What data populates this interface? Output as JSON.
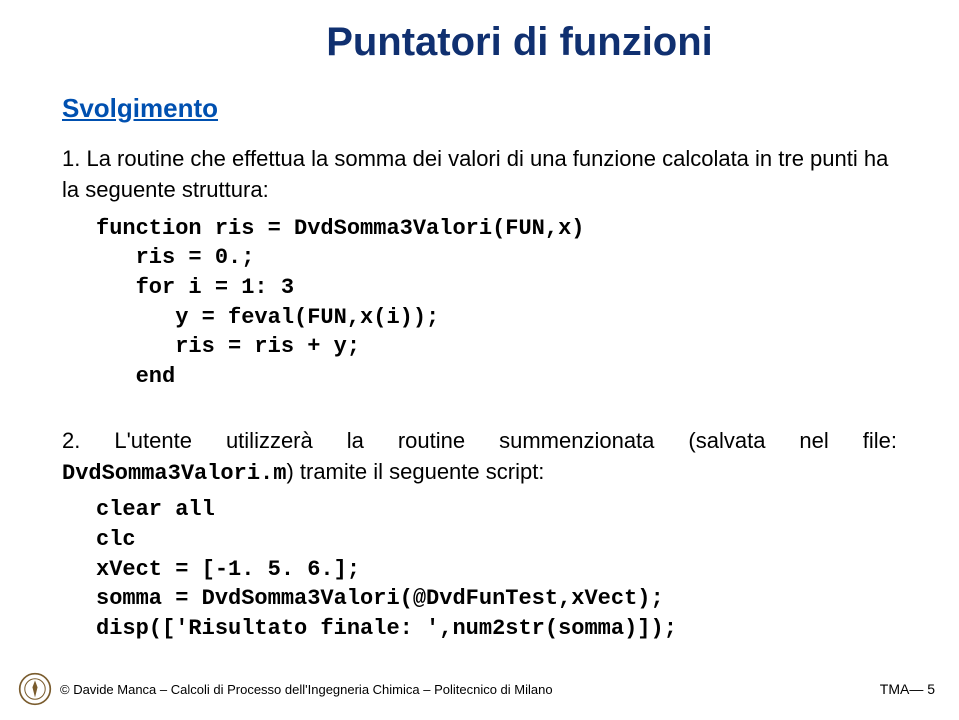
{
  "title": "Puntatori di funzioni",
  "section": "Svolgimento",
  "item1": {
    "num": "1.",
    "text_a": " La routine che effettua la somma dei valori di una funzione calcolata in tre punti ha la seguente struttura:"
  },
  "code1": {
    "l1": "function ris = DvdSomma3Valori(FUN,x)",
    "l2": "   ris = 0.;",
    "l3": "   for i = 1: 3",
    "l4": "      y = feval(FUN,x(i));",
    "l5": "      ris = ris + y;",
    "l6": "   end"
  },
  "item2": {
    "num": "2.",
    "text_a": " L'utente utilizzerà la routine summenzionata (salvata nel file: ",
    "file": "DvdSomma3Valori.m",
    "text_b": ") tramite il seguente script:"
  },
  "code2": {
    "l1": "clear all",
    "l2": "clc",
    "l3": "xVect = [-1. 5. 6.];",
    "l4": "somma = DvdSomma3Valori(@DvdFunTest,xVect);",
    "l5": "disp(['Risultato finale: ',num2str(somma)]);"
  },
  "footer": {
    "copyright": "© Davide Manca – Calcoli di Processo dell'Ingegneria Chimica – Politecnico di Milano",
    "slidenum": "TMA— 5"
  }
}
